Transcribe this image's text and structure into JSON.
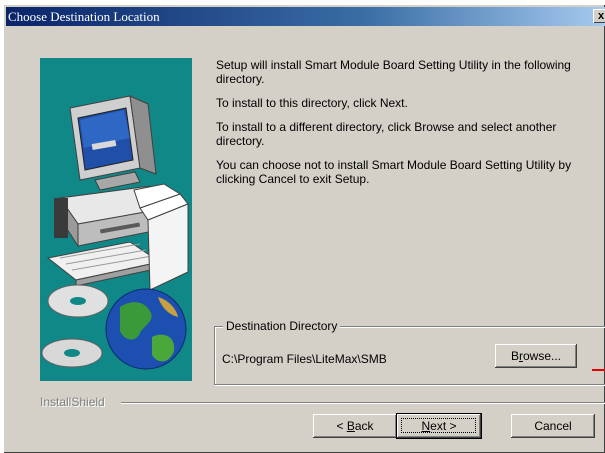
{
  "window": {
    "title": "Choose Destination Location",
    "close_glyph": "x"
  },
  "body_text": {
    "p1": "Setup will install Smart Module Board Setting Utility in the following directory.",
    "p2": "To install to this directory, click Next.",
    "p3": "To install to a different directory, click Browse and select another directory.",
    "p4": "You can choose not to install Smart Module Board Setting Utility by clicking Cancel to exit Setup."
  },
  "destination": {
    "legend": "Destination Directory",
    "path": "C:\\Program Files\\LiteMax\\SMB",
    "browse_pre": "B",
    "browse_accel": "r",
    "browse_post": "owse..."
  },
  "footer": {
    "brand": "InstallShield",
    "back_pre": "< ",
    "back_accel": "B",
    "back_post": "ack",
    "next_accel": "N",
    "next_post": "ext >",
    "cancel": "Cancel"
  },
  "icons": [
    "computer-icon",
    "cd-disc-icon",
    "globe-icon"
  ],
  "colors": {
    "illustration_bg": "#108888",
    "title_bar": "#0a246a",
    "annotation_arrow": "#e00000"
  }
}
